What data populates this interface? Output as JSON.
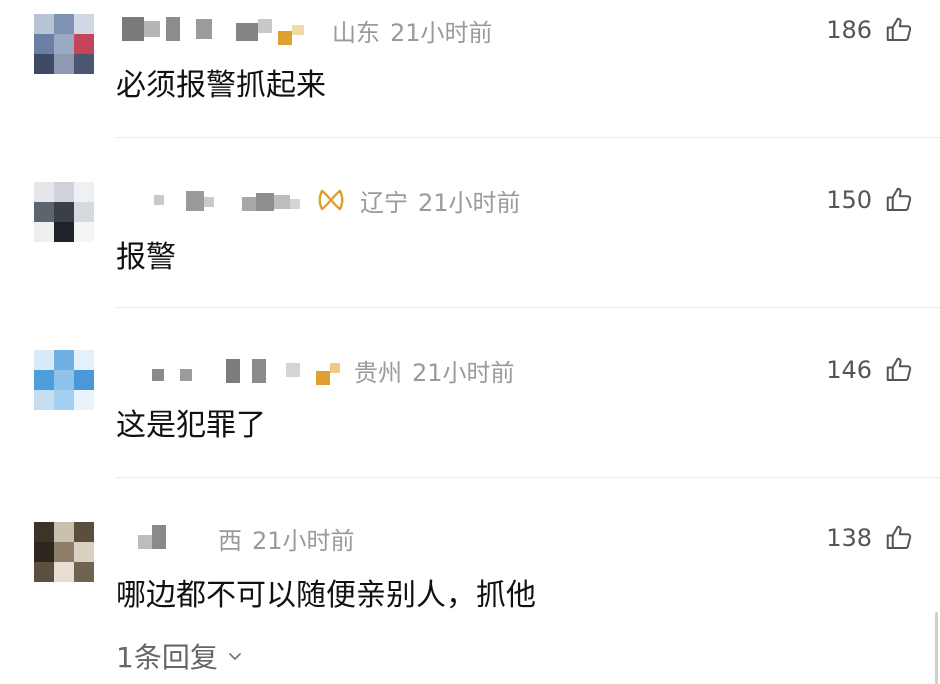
{
  "comments": [
    {
      "location": "山东",
      "time": "21小时前",
      "text": "必须报警抓起来",
      "likes": "186",
      "badge_icon": "orange-square-icon"
    },
    {
      "location": "辽宁",
      "time": "21小时前",
      "text": "报警",
      "likes": "150",
      "badge_icon": "gold-ribbon-icon"
    },
    {
      "location": "贵州",
      "time": "21小时前",
      "text": "这是犯罪了",
      "likes": "146",
      "badge_icon": "orange-square-icon"
    },
    {
      "location": "西",
      "time": "21小时前",
      "text": "哪边都不可以随便亲别人，抓他",
      "likes": "138",
      "badge_icon": ""
    }
  ],
  "replies_label": "1条回复",
  "colors": {
    "meta_gray": "#9a9a9a",
    "badge_orange": "#e0a030",
    "text": "#111111"
  }
}
